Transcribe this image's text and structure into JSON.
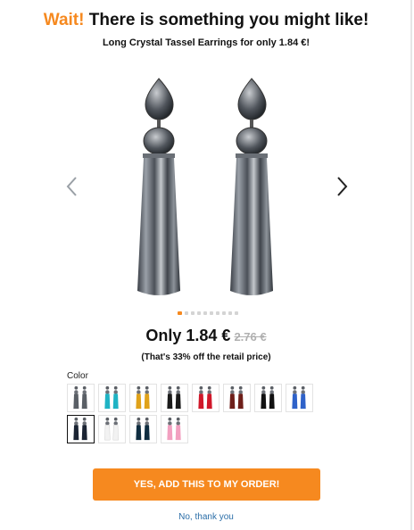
{
  "popup": {
    "headline_accent": "Wait!",
    "headline_rest": " There is something you might like!",
    "subheadline": "Long Crystal Tassel Earrings for only 1.84 €!"
  },
  "product": {
    "image_icon": "tassel-earrings-image",
    "main_color": "#4a4f57",
    "slide_count": 10,
    "active_slide": 1
  },
  "price": {
    "current": "Only 1.84 €",
    "old": "2.76 €",
    "discount_note": "(That's 33% off the retail price)"
  },
  "color_picker": {
    "label": "Color",
    "selected_index": 8,
    "options": [
      {
        "color": "#5a5f66"
      },
      {
        "color": "#1fb3c4"
      },
      {
        "color": "#e0a21a"
      },
      {
        "color": "#1a1a1a"
      },
      {
        "color": "#d0182a"
      },
      {
        "color": "#6e1f1a"
      },
      {
        "color": "#111111"
      },
      {
        "color": "#2f62c9"
      },
      {
        "color": "#1b2433"
      },
      {
        "color": "#f2f2f2"
      },
      {
        "color": "#0f2d40"
      },
      {
        "color": "#f2a0c0"
      }
    ]
  },
  "actions": {
    "add_label": "YES, ADD THIS TO MY ORDER!",
    "decline_label": "No, thank you"
  },
  "colors": {
    "accent": "#f6891f",
    "link": "#2b6ea8"
  }
}
